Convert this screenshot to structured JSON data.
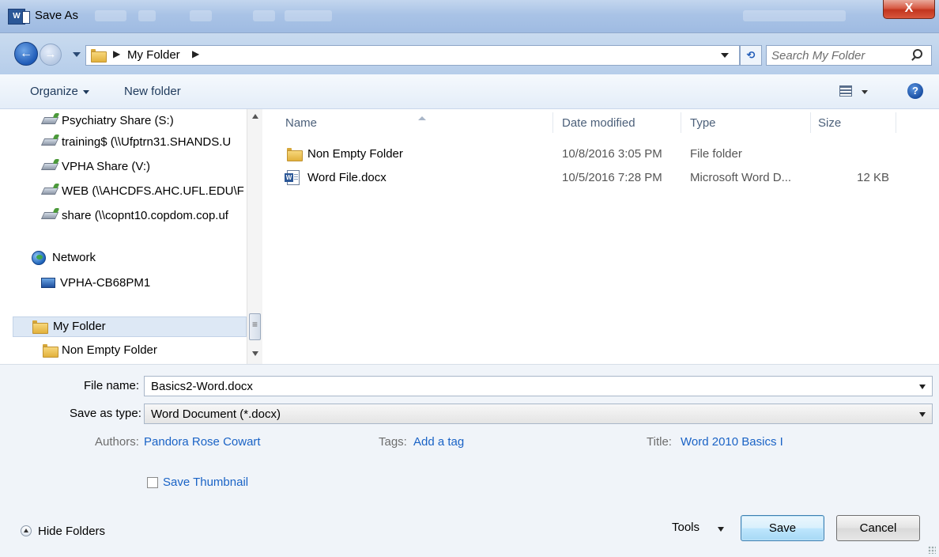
{
  "window": {
    "title": "Save As",
    "close_label": "X"
  },
  "address_bar": {
    "crumbs": [
      "My Folder"
    ],
    "search_placeholder": "Search My Folder"
  },
  "toolbar": {
    "organize_label": "Organize",
    "new_folder_label": "New folder",
    "help_label": "?"
  },
  "nav": {
    "drives": [
      {
        "label": "Psychiatry Share (S:)",
        "icon": "network-drive-icon"
      },
      {
        "label": "training$ (\\\\Ufptrn31.SHANDS.U",
        "icon": "network-drive-icon"
      },
      {
        "label": "VPHA Share (V:)",
        "icon": "network-drive-icon"
      },
      {
        "label": "WEB (\\\\AHCDFS.AHC.UFL.EDU\\F",
        "icon": "network-drive-icon"
      },
      {
        "label": "share (\\\\copnt10.copdom.cop.uf",
        "icon": "network-drive-icon"
      }
    ],
    "network_label": "Network",
    "computer_label": "VPHA-CB68PM1",
    "folders": [
      {
        "label": "My Folder",
        "selected": true
      },
      {
        "label": "Non Empty Folder",
        "selected": false
      }
    ]
  },
  "file_list": {
    "columns": {
      "name": "Name",
      "date": "Date modified",
      "type": "Type",
      "size": "Size"
    },
    "rows": [
      {
        "name": "Non Empty Folder",
        "date": "10/8/2016 3:05 PM",
        "type": "File folder",
        "size": "",
        "icon": "folder-icon"
      },
      {
        "name": "Word File.docx",
        "date": "10/5/2016 7:28 PM",
        "type": "Microsoft Word D...",
        "size": "12 KB",
        "icon": "word-doc-icon"
      }
    ]
  },
  "form": {
    "file_name_label": "File name:",
    "file_name_value": "Basics2-Word.docx",
    "save_type_label": "Save as type:",
    "save_type_value": "Word Document (*.docx)",
    "authors_label": "Authors:",
    "authors_value": "Pandora Rose Cowart",
    "tags_label": "Tags:",
    "tags_value": "Add a tag",
    "title_label": "Title:",
    "title_value": "Word 2010 Basics I",
    "thumbnail_label": "Save Thumbnail",
    "thumbnail_checked": false
  },
  "footer": {
    "hide_folders_label": "Hide Folders",
    "tools_label": "Tools",
    "save_label": "Save",
    "cancel_label": "Cancel"
  },
  "colors": {
    "link": "#1a63c6",
    "titlebar": "#a9c3e6",
    "close": "#c2351e"
  }
}
